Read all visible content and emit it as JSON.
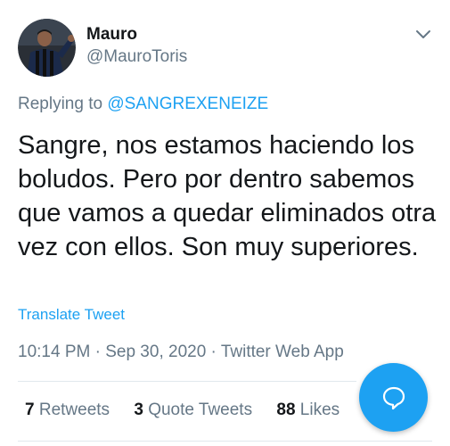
{
  "author": {
    "name": "Mauro",
    "handle": "@MauroToris",
    "avatar_icon": "avatar-photo"
  },
  "reply": {
    "prefix": "Replying to",
    "mention": "@SANGREXENEIZE"
  },
  "tweet": {
    "text": "Sangre, nos estamos haciendo los boludos. Pero por dentro sabemos que vamos a quedar eliminados otra vez con ellos. Son muy superiores.",
    "translate_label": "Translate Tweet"
  },
  "meta": {
    "time": "10:14 PM",
    "date": "Sep 30, 2020",
    "source": "Twitter Web App"
  },
  "stats": {
    "retweets_count": "7",
    "retweets_label": "Retweets",
    "quotes_count": "3",
    "quotes_label": "Quote Tweets",
    "likes_count": "88",
    "likes_label": "Likes"
  },
  "colors": {
    "accent": "#1da1f2",
    "text": "#14171a",
    "secondary": "#657786",
    "divider": "#e1e8ed"
  },
  "icons": {
    "menu": "chevron-down-icon",
    "compose": "chat-bubble-icon"
  }
}
